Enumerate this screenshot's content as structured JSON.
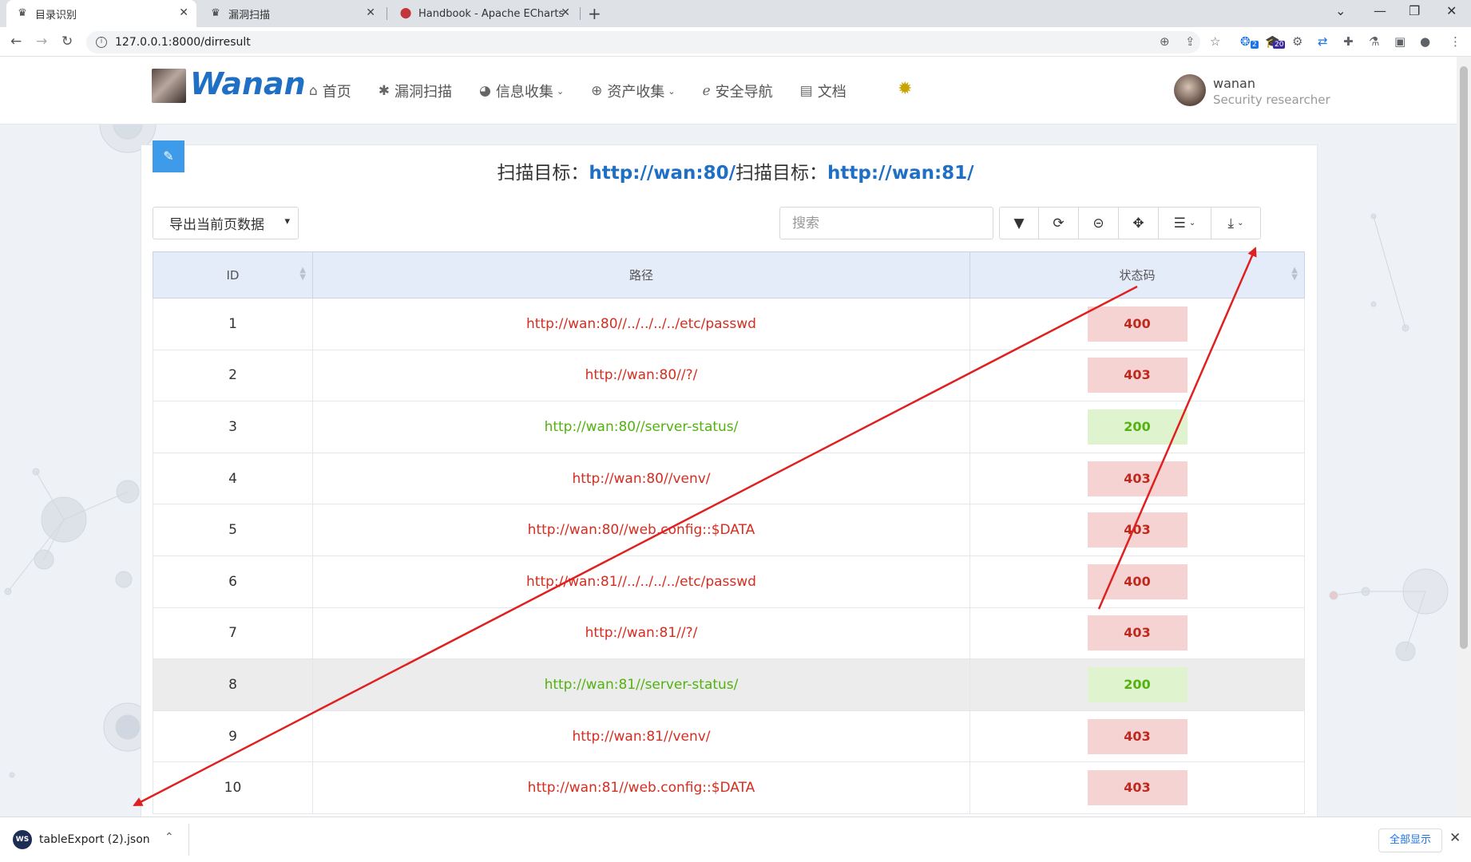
{
  "browser": {
    "tabs": [
      {
        "title": "目录识别",
        "icon": "crown-icon"
      },
      {
        "title": "漏洞扫描",
        "icon": "crown-icon"
      },
      {
        "title": "Handbook - Apache ECharts",
        "icon": "echarts-icon"
      }
    ],
    "url": "127.0.0.1:8000/dirresult",
    "extension_badges": {
      "badge_a": "2",
      "badge_b": "20"
    }
  },
  "header": {
    "logo_text": "Wanan",
    "nav": [
      {
        "label": "首页",
        "icon": "home-icon"
      },
      {
        "label": "漏洞扫描",
        "icon": "bug-icon"
      },
      {
        "label": "信息收集",
        "icon": "globe-icon",
        "dropdown": true
      },
      {
        "label": "资产收集",
        "icon": "globe-icon",
        "dropdown": true
      },
      {
        "label": "安全导航",
        "icon": "ie-icon"
      },
      {
        "label": "文档",
        "icon": "document-icon"
      }
    ],
    "user": {
      "name": "wanan",
      "role": "Security researcher"
    }
  },
  "main": {
    "title_prefix_1": "扫描目标：",
    "target_1": "http://wan:80/",
    "title_prefix_2": "扫描目标：",
    "target_2": "http://wan:81/",
    "export_select": "导出当前页数据",
    "search_placeholder": "搜索",
    "columns": [
      "ID",
      "路径",
      "状态码"
    ],
    "rows": [
      {
        "id": "1",
        "path": "http://wan:80//../../../../etc/passwd",
        "status": "400",
        "color": "red"
      },
      {
        "id": "2",
        "path": "http://wan:80//?/",
        "status": "403",
        "color": "red"
      },
      {
        "id": "3",
        "path": "http://wan:80//server-status/",
        "status": "200",
        "color": "green"
      },
      {
        "id": "4",
        "path": "http://wan:80//venv/",
        "status": "403",
        "color": "red"
      },
      {
        "id": "5",
        "path": "http://wan:80//web.config::$DATA",
        "status": "403",
        "color": "red"
      },
      {
        "id": "6",
        "path": "http://wan:81//../../../../etc/passwd",
        "status": "400",
        "color": "red"
      },
      {
        "id": "7",
        "path": "http://wan:81//?/",
        "status": "403",
        "color": "red"
      },
      {
        "id": "8",
        "path": "http://wan:81//server-status/",
        "status": "200",
        "color": "green",
        "highlight": true
      },
      {
        "id": "9",
        "path": "http://wan:81//venv/",
        "status": "403",
        "color": "red"
      },
      {
        "id": "10",
        "path": "http://wan:81//web.config::$DATA",
        "status": "403",
        "color": "red"
      }
    ]
  },
  "downloads": {
    "file_name": "tableExport (2).json",
    "icon_text": "WS",
    "show_all": "全部显示"
  },
  "colors": {
    "accent": "#1f6fc5",
    "error": "#d62d20",
    "success": "#52b20e",
    "annotation": "#e02020"
  }
}
